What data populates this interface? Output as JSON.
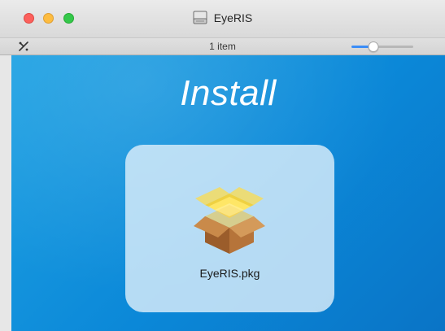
{
  "window": {
    "title": "EyeRIS",
    "status_text": "1 item",
    "icon_zoom_level": 0.35
  },
  "content": {
    "heading": "Install",
    "items": [
      {
        "name": "EyeRIS.pkg",
        "icon": "package-icon"
      }
    ]
  },
  "colors": {
    "background_blue": "#0b88d8",
    "card_tint": "#dceefa",
    "slider_accent": "#3b8df7"
  }
}
